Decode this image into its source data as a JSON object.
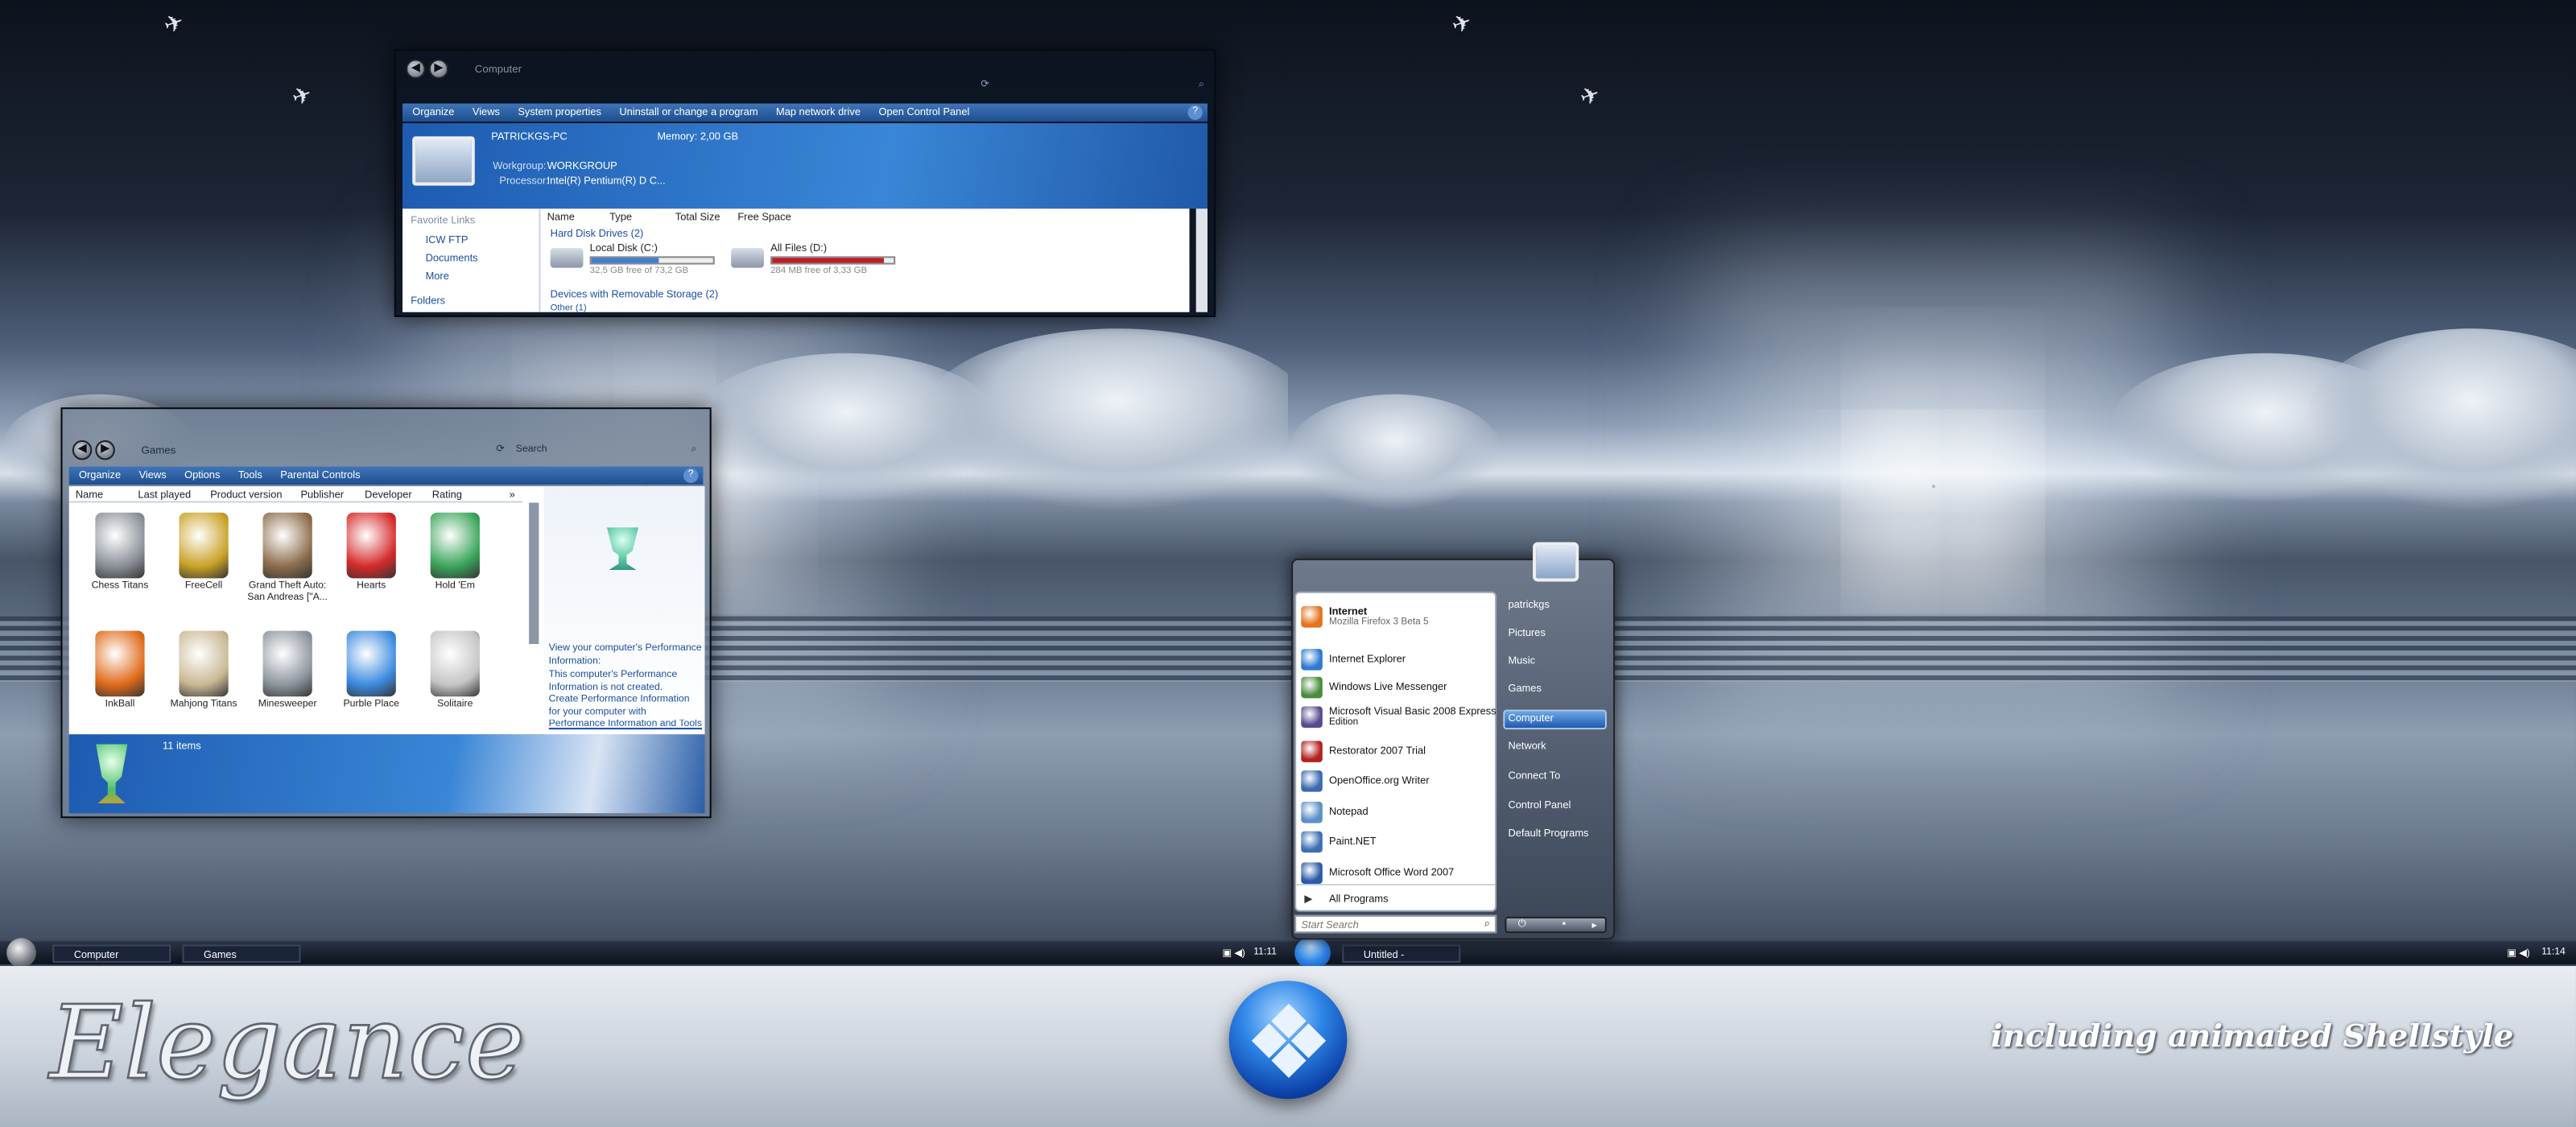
{
  "computer_window": {
    "address": "Computer",
    "toolbar": [
      "Organize",
      "Views",
      "System properties",
      "Uninstall or change a program",
      "Map network drive",
      "Open Control Panel"
    ],
    "pc_name": "PATRICKGS-PC",
    "memory": "Memory: 2,00 GB",
    "workgroup_label": "Workgroup:",
    "workgroup": "WORKGROUP",
    "processor_label": "Processor:",
    "processor": "Intel(R) Pentium(R) D C...",
    "favorite_links_title": "Favorite Links",
    "links": [
      "ICW FTP",
      "Documents",
      "More"
    ],
    "folders_label": "Folders",
    "columns": [
      "Name",
      "Type",
      "Total Size",
      "Free Space"
    ],
    "groups": {
      "hdd": "Hard Disk Drives (2)",
      "removable": "Devices with Removable Storage (2)",
      "other": "Other (1)"
    },
    "drives": [
      {
        "name": "Local Disk (C:)",
        "free": "32,5 GB free of 73,2 GB",
        "used_fraction": 0.56,
        "color": "#3b7fd6"
      },
      {
        "name": "All Files (D:)",
        "free": "284 MB free of 3,33 GB",
        "used_fraction": 0.92,
        "color": "#c21d24"
      }
    ]
  },
  "games_window": {
    "address": "Games",
    "search": "Search",
    "toolbar": [
      "Organize",
      "Views",
      "Options",
      "Tools",
      "Parental Controls"
    ],
    "columns": [
      "Name",
      "Last played",
      "Product version",
      "Publisher",
      "Developer",
      "Rating"
    ],
    "games": [
      "Chess Titans",
      "FreeCell",
      "Grand Theft Auto: San Andreas [\"A...",
      "Hearts",
      "Hold 'Em",
      "InkBall",
      "Mahjong Titans",
      "Minesweeper",
      "Purble Place",
      "Solitaire"
    ],
    "perf_link": "View your computer's Performance Information:",
    "perf_text1": "This computer's Performance Information is not created.",
    "perf_text2": "Create Performance Information for your computer with",
    "perf_link2": "Performance Information and Tools",
    "count": "11 items"
  },
  "taskbar_left": {
    "buttons": [
      "Computer",
      "Games"
    ],
    "clock": "11:11"
  },
  "taskbar_right": {
    "buttons": [
      "Untitled - Paint.NET..."
    ],
    "clock": "11:14"
  },
  "start_menu": {
    "left": [
      {
        "name": "Internet",
        "sub": "Mozilla Firefox 3 Beta 5",
        "color": "#e5721c"
      },
      {
        "name": "Internet Explorer",
        "sub": "",
        "color": "#2f79d1"
      },
      {
        "name": "Windows Live Messenger",
        "sub": "",
        "color": "#4a8c3f"
      },
      {
        "name": "Microsoft Visual Basic 2008 Express",
        "sub": "Edition",
        "color": "#5a4a8f"
      },
      {
        "name": "Restorator 2007 Trial",
        "sub": "",
        "color": "#b32020"
      },
      {
        "name": "OpenOffice.org Writer",
        "sub": "",
        "color": "#3a6ab0"
      },
      {
        "name": "Notepad",
        "sub": "",
        "color": "#5b8fc7"
      },
      {
        "name": "Paint.NET",
        "sub": "",
        "color": "#3c6fb3"
      },
      {
        "name": "Microsoft Office Word 2007",
        "sub": "",
        "color": "#2a5aa8"
      }
    ],
    "all_programs": "All Programs",
    "search": "Start Search",
    "right": [
      "patrickgs",
      "Pictures",
      "Music",
      "Games",
      "Computer",
      "Network",
      "Connect To",
      "Control Panel",
      "Default Programs"
    ],
    "highlight": "Computer"
  },
  "banner": {
    "title": "Elegance",
    "subtitle": "including animated Shellstyle"
  }
}
